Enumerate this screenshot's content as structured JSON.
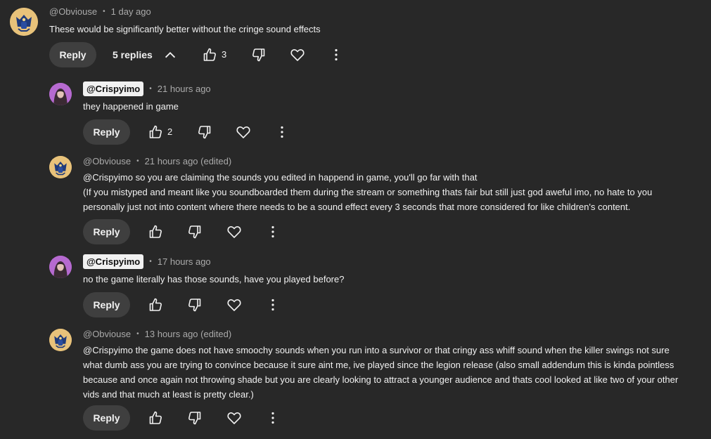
{
  "top_comment": {
    "author": "@Obviouse",
    "time": "1 day ago",
    "text": "These would be significantly better without the cringe sound effects",
    "reply_label": "Reply",
    "replies_label": "5 replies",
    "likes": "3"
  },
  "replies": [
    {
      "author": "@Crispyimo",
      "time": "21 hours ago",
      "text": "they happened in game",
      "reply_label": "Reply",
      "likes": "2"
    },
    {
      "author": "@Obviouse",
      "time": "21 hours ago (edited)",
      "text": "@Crispyimo so you are claiming the sounds you edited in happend in game, you'll go far with that\n(If you mistyped and meant like you soundboarded them during the stream or something thats fair but still just god aweful imo, no hate to you\npersonally just not into content where there needs to be a sound effect every 3 seconds that more considered for like children's content.",
      "reply_label": "Reply"
    },
    {
      "author": "@Crispyimo",
      "time": "17 hours ago",
      "text": "no the game literally has those sounds, have you played before?",
      "reply_label": "Reply"
    },
    {
      "author": "@Obviouse",
      "time": "13 hours ago (edited)",
      "text": "@Crispyimo the game does not have smoochy sounds when you run into a survivor or that cringy ass whiff sound when the killer swings not sure\nwhat dumb ass you are trying to convince because it sure aint me, ive played since the legion release (also small addendum this is kinda pointless\nbecause and once again not throwing shade but you are clearly looking to attract a younger audience and thats cool looked at like two of your other\nvids and that much at least is pretty clear.)",
      "reply_label": "Reply"
    }
  ],
  "colors": {
    "background": "#282828",
    "button_bg": "#3f3f3f",
    "text": "#f1f1f1",
    "meta": "#aaaaaa"
  },
  "icons": [
    "thumb-up-icon",
    "thumb-down-icon",
    "heart-icon",
    "more-vert-icon",
    "chevron-up-icon"
  ]
}
